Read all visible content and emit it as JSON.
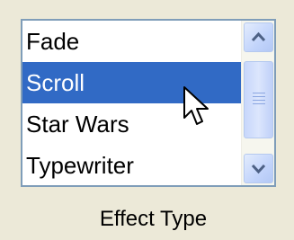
{
  "listbox": {
    "items": [
      {
        "label": "Fade",
        "selected": false
      },
      {
        "label": "Scroll",
        "selected": true
      },
      {
        "label": "Star Wars",
        "selected": false
      },
      {
        "label": "Typewriter",
        "selected": false
      }
    ]
  },
  "scrollbar": {
    "up_icon": "chevron-up-icon",
    "down_icon": "chevron-down-icon",
    "thumb_grip_icon": "grip-icon"
  },
  "caption": "Effect Type",
  "colors": {
    "selection": "#316ac5",
    "border": "#7f9db9",
    "background": "#ece9d8"
  }
}
